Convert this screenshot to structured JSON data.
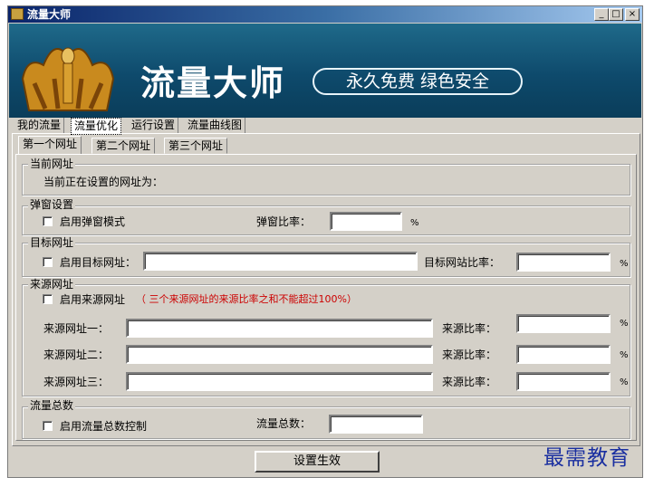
{
  "window": {
    "title": "流量大师",
    "minimize": "_",
    "maximize": "□",
    "close": "×"
  },
  "banner": {
    "title": "流量大师",
    "slogan": "永久免费 绿色安全"
  },
  "main_tabs": [
    {
      "label": "我的流量"
    },
    {
      "label": "流量优化",
      "selected": true
    },
    {
      "label": "运行设置"
    },
    {
      "label": "流量曲线图"
    }
  ],
  "sub_tabs": [
    {
      "label": "第一个网址",
      "selected": true
    },
    {
      "label": "第二个网址"
    },
    {
      "label": "第三个网址"
    }
  ],
  "current_url": {
    "legend": "当前网址",
    "text": "当前正在设置的网址为："
  },
  "popup": {
    "legend": "弹窗设置",
    "enable_label": "启用弹窗模式",
    "ratio_label": "弹窗比率：",
    "ratio_value": "",
    "unit": "%"
  },
  "target": {
    "legend": "目标网址",
    "enable_label": "启用目标网址：",
    "url_value": "",
    "ratio_label": "目标网站比率：",
    "ratio_value": "",
    "unit": "%"
  },
  "source": {
    "legend": "来源网址",
    "enable_label": "启用来源网址",
    "warning": "（ 三个来源网址的来源比率之和不能超过100%）",
    "rows": [
      {
        "label": "来源网址一：",
        "url": "",
        "ratio_label": "来源比率：",
        "ratio": "",
        "unit": "%"
      },
      {
        "label": "来源网址二：",
        "url": "",
        "ratio_label": "来源比率：",
        "ratio": "",
        "unit": "%"
      },
      {
        "label": "来源网址三：",
        "url": "",
        "ratio_label": "来源比率：",
        "ratio": "",
        "unit": "%"
      }
    ]
  },
  "total": {
    "legend": "流量总数",
    "enable_label": "启用流量总数控制",
    "total_label": "流量总数：",
    "total_value": ""
  },
  "apply_button": "设置生效",
  "watermark": "最需教育"
}
